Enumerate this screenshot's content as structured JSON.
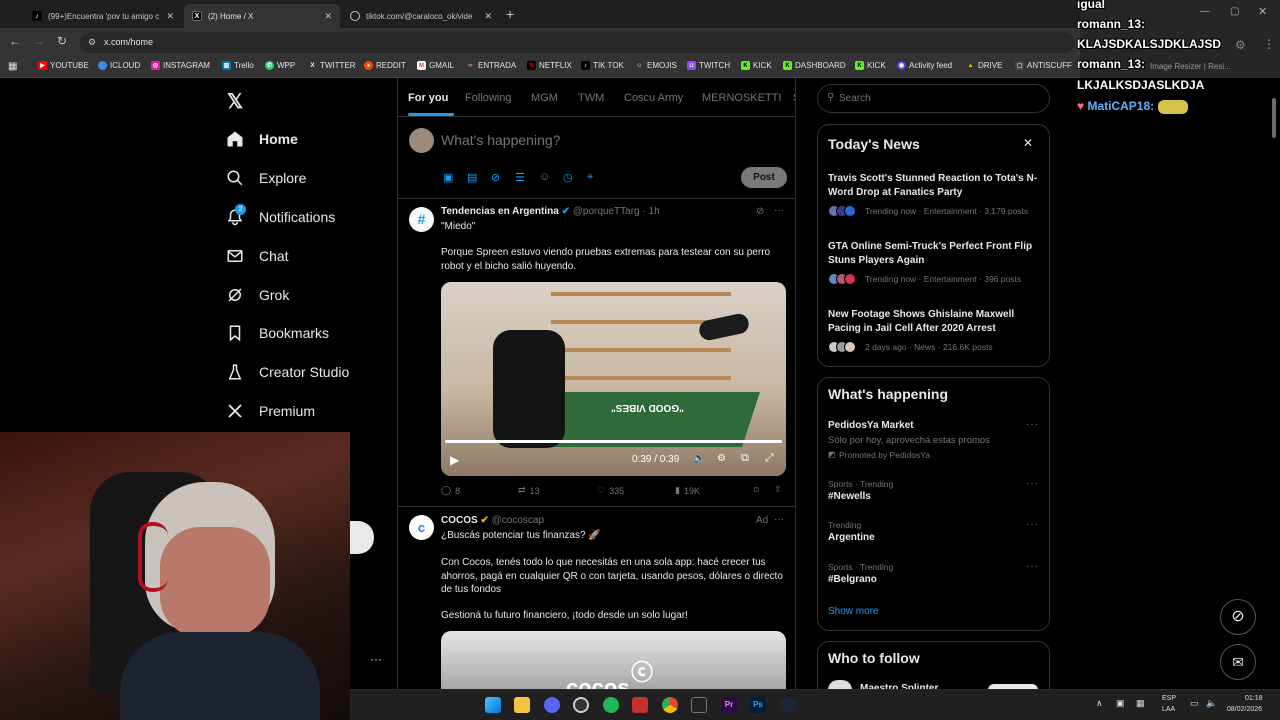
{
  "browser": {
    "tabs": [
      {
        "label": "(99+)Encuentra 'pov tu amigo c",
        "active": false
      },
      {
        "label": "(2) Home / X",
        "active": true
      },
      {
        "label": "tiktok.com/@caraloco_ok/vide",
        "active": false
      }
    ],
    "url": "x.com/home",
    "bookmarks": [
      "YOUTUBE",
      "ICLOUD",
      "INSTAGRAM",
      "Trello",
      "WPP",
      "TWITTER",
      "REDDIT",
      "GMAIL",
      "ENTRADA",
      "NETFLIX",
      "TIK TOK",
      "EMOJIS",
      "TWITCH",
      "KICK",
      "DASHBOARD",
      "KICK",
      "Activity feed",
      "DRIVE",
      "ANTISCUFF"
    ]
  },
  "extension_popup": {
    "label": "Image Resizer | Resi..."
  },
  "sidebar": {
    "items": [
      {
        "label": "Home",
        "icon": "home-icon"
      },
      {
        "label": "Explore",
        "icon": "search-icon"
      },
      {
        "label": "Notifications",
        "icon": "bell-icon",
        "badge": "2"
      },
      {
        "label": "Chat",
        "icon": "mail-icon"
      },
      {
        "label": "Grok",
        "icon": "grok-icon"
      },
      {
        "label": "Bookmarks",
        "icon": "bookmark-icon"
      },
      {
        "label": "Creator Studio",
        "icon": "creator-icon"
      },
      {
        "label": "Premium",
        "icon": "x-icon"
      }
    ],
    "more": "···"
  },
  "feed": {
    "tabs": [
      "For you",
      "Following",
      "MGM",
      "TWM",
      "Coscu Army",
      "MERNOSKETTI",
      "S"
    ],
    "composer": {
      "placeholder": "What's happening?",
      "post_button": "Post"
    },
    "tweet1": {
      "name": "Tendencias en Argentina",
      "handle": "@porqueTTarg",
      "time": "1h",
      "text1": "\"Miedo\"",
      "text2": "Porque Spreen estuvo viendo pruebas extremas para testear con su perro robot y el bicho salió huyendo.",
      "video_time": "0:39 / 0:39",
      "rug_text": "\"GOOD VIBES\"",
      "replies": "8",
      "reposts": "13",
      "likes": "335",
      "views": "19K"
    },
    "tweet2": {
      "name": "COCOS",
      "handle": "@cocoscap",
      "ad": "Ad",
      "text1": "¿Buscás potenciar tus finanzas? 🚀",
      "text2": "Con Cocos, tenés todo lo que necesitás en una sola app: hacé crecer tus ahorros, pagá en cualquier QR o con tarjeta, usando pesos, dólares o directo de tus fondos",
      "text3": "Gestioná tu futuro financiero, ¡todo desde un solo lugar!",
      "image_text": "cocos"
    }
  },
  "right": {
    "search_placeholder": "Search",
    "news": {
      "title": "Today's News",
      "items": [
        {
          "title": "Travis Scott's Stunned Reaction to Tota's N-Word Drop at Fanatics Party",
          "meta": "Trending now · Entertainment · 3,179 posts"
        },
        {
          "title": "GTA Online Semi-Truck's Perfect Front Flip Stuns Players Again",
          "meta": "Trending now · Entertainment · 396 posts"
        },
        {
          "title": "New Footage Shows Ghislaine Maxwell Pacing in Jail Cell After 2020 Arrest",
          "meta": "2 days ago · News · 216.6K posts"
        }
      ]
    },
    "happening": {
      "title": "What's happening",
      "promo": {
        "name": "PedidosYa Market",
        "desc": "Sólo por hoy, aprovechá estas promos",
        "promoted": "Promoted by PedidosYa"
      },
      "trends": [
        {
          "sub": "Sports · Trending",
          "name": "#Newells"
        },
        {
          "sub": "Trending",
          "name": "Argentine"
        },
        {
          "sub": "Sports · Trending",
          "name": "#Belgrano"
        }
      ],
      "show_more": "Show more"
    },
    "follow": {
      "title": "Who to follow",
      "first": "Maestro Splinter"
    }
  },
  "chat": [
    {
      "text": "igual"
    },
    {
      "user": "romann_13:",
      "msg": "KLAJSDKALSJDKLAJSD"
    },
    {
      "user": "romann_13:",
      "msg": "LKJALKSDJASLKDJA"
    },
    {
      "user": "MatiCAP18:"
    }
  ],
  "taskbar": {
    "lang1": "ESP",
    "lang2": "LAA",
    "time": "01:18",
    "date": "08/02/2026"
  },
  "colors": {
    "accent": "#1d9bf0",
    "bg": "#000000",
    "border": "#2f3336",
    "muted": "#71767b"
  }
}
